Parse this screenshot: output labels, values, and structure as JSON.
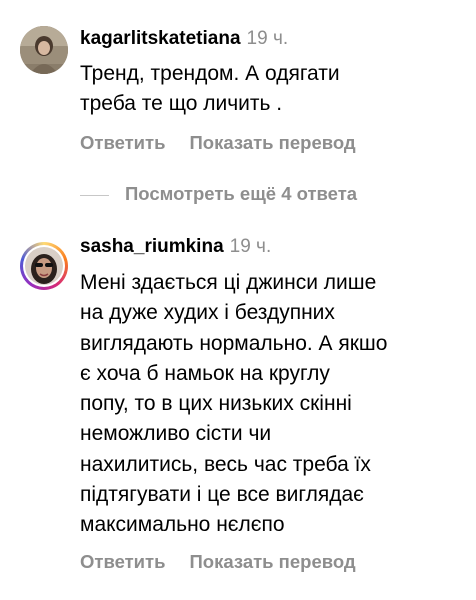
{
  "comments": [
    {
      "username": "kagarlitskatetiana",
      "time": "19 ч.",
      "text": "Тренд, трендом. А одягати\nтреба те що личить .",
      "actions": {
        "reply": "Ответить",
        "translate": "Показать перевод"
      }
    },
    {
      "username": "sasha_riumkina",
      "time": "19 ч.",
      "text": "Мені здається ці джинси лише\nна дуже худих і бездупних\nвиглядають нормально. А якшо\nє хоча б намьок на круглу\nпопу, то в цих низьких скінні\nнеможливо сісти чи\nнахилитись, весь час треба їх\nпідтягувати і це все виглядає\nмаксимально нєлєпо",
      "actions": {
        "reply": "Ответить",
        "translate": "Показать перевод"
      }
    }
  ],
  "view_more_replies": "Посмотреть ещё 4 ответа",
  "colors": {
    "secondary_text": "#8e8e8e",
    "divider": "#c7c7c7"
  }
}
